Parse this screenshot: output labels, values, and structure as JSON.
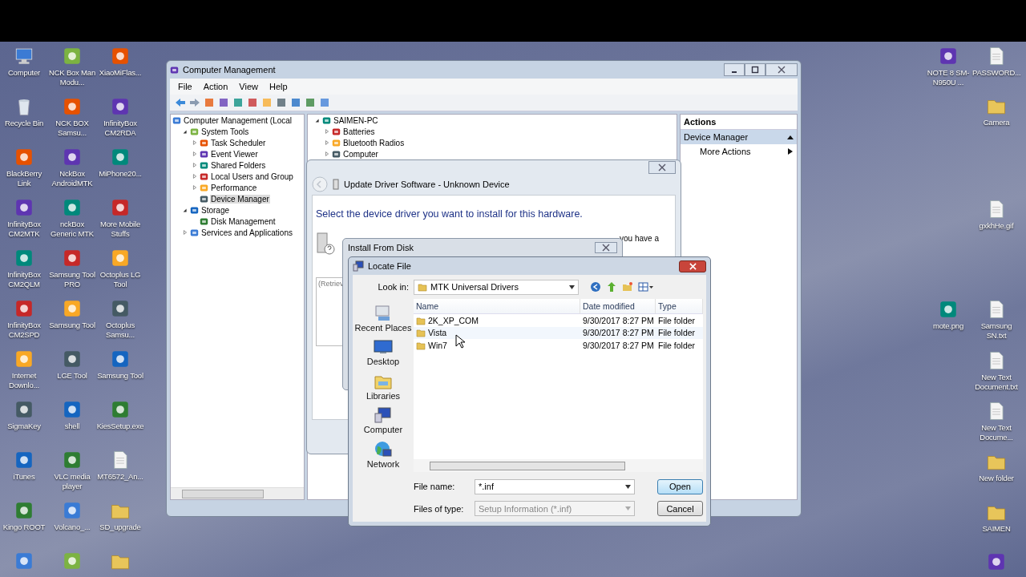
{
  "desktop": {
    "left_columns": [
      [
        {
          "label": "Computer",
          "kind": "computer"
        },
        {
          "label": "Recycle Bin",
          "kind": "bin"
        },
        {
          "label": "BlackBerry Link",
          "kind": "app"
        },
        {
          "label": "InfinityBox CM2MTK",
          "kind": "app"
        },
        {
          "label": "InfinityBox CM2QLM",
          "kind": "app"
        },
        {
          "label": "InfinityBox CM2SPD",
          "kind": "app"
        },
        {
          "label": "Internet Downlo...",
          "kind": "app"
        },
        {
          "label": "SigmaKey",
          "kind": "app"
        },
        {
          "label": "iTunes",
          "kind": "app"
        },
        {
          "label": "Kingo ROOT",
          "kind": "app"
        },
        {
          "kind": "app"
        }
      ],
      [
        {
          "label": "NCK Box Man Modu...",
          "kind": "app"
        },
        {
          "label": "NCK BOX Samsu...",
          "kind": "app"
        },
        {
          "label": "NckBox AndroidMTK",
          "kind": "app"
        },
        {
          "label": "nckBox Generic MTK",
          "kind": "app"
        },
        {
          "label": "Samsung Tool PRO",
          "kind": "app"
        },
        {
          "label": "Samsung Tool",
          "kind": "app"
        },
        {
          "label": "LGE Tool",
          "kind": "app"
        },
        {
          "label": "shell",
          "kind": "app"
        },
        {
          "label": "VLC media player",
          "kind": "app"
        },
        {
          "label": "Volcano_...",
          "kind": "app"
        },
        {
          "kind": "app"
        }
      ],
      [
        {
          "label": "XiaoMiFlas...",
          "kind": "app"
        },
        {
          "label": "InfinityBox CM2RDA",
          "kind": "app"
        },
        {
          "label": "MiPhone20...",
          "kind": "app"
        },
        {
          "label": "More Mobile Stuffs",
          "kind": "app"
        },
        {
          "label": "Octoplus LG Tool",
          "kind": "app"
        },
        {
          "label": "Octoplus Samsu...",
          "kind": "app"
        },
        {
          "label": "Samsung Tool",
          "kind": "app"
        },
        {
          "label": "KiesSetup.exe",
          "kind": "app"
        },
        {
          "label": "MT6572_An...",
          "kind": "document"
        },
        {
          "label": "SD_upgrade",
          "kind": "folder"
        },
        {
          "kind": "folder"
        }
      ]
    ],
    "right_columns": [
      [
        {
          "label": "NOTE 8 SM-N950U ...",
          "kind": "app"
        },
        {
          "label": "mote.png",
          "kind": "app"
        }
      ],
      [
        {
          "label": "PASSWORD...",
          "kind": "document"
        },
        {
          "label": "Camera",
          "kind": "folder"
        },
        {
          "label": "gxkhHe.gif",
          "kind": "document"
        },
        {
          "label": "Samsung SN.txt",
          "kind": "document"
        },
        {
          "label": "New Text Document.txt",
          "kind": "document"
        },
        {
          "label": "New Text Docume...",
          "kind": "document"
        },
        {
          "label": "New folder",
          "kind": "folder"
        },
        {
          "label": "SAIMEN",
          "kind": "folder"
        },
        {
          "kind": "app"
        }
      ]
    ]
  },
  "computer_management": {
    "title": "Computer Management",
    "menu": [
      "File",
      "Action",
      "View",
      "Help"
    ],
    "tree": [
      {
        "label": "Computer Management (Local",
        "selected": false,
        "children": [
          {
            "label": "System Tools",
            "expanded": true,
            "selected": false,
            "children": [
              {
                "label": "Task Scheduler",
                "expanded": false,
                "selected": false
              },
              {
                "label": "Event Viewer",
                "expanded": false,
                "selected": false
              },
              {
                "label": "Shared Folders",
                "expanded": false,
                "selected": false
              },
              {
                "label": "Local Users and Group",
                "expanded": false,
                "selected": false
              },
              {
                "label": "Performance",
                "expanded": false,
                "selected": false
              },
              {
                "label": "Device Manager",
                "selected": true
              }
            ]
          },
          {
            "label": "Storage",
            "expanded": true,
            "selected": false,
            "children": [
              {
                "label": "Disk Management",
                "selected": false
              }
            ]
          },
          {
            "label": "Services and Applications",
            "expanded": false,
            "selected": false
          }
        ]
      }
    ],
    "devices": [
      {
        "label": "SAIMEN-PC",
        "expanded": true,
        "children": [
          {
            "label": "Batteries",
            "expanded": false
          },
          {
            "label": "Bluetooth Radios",
            "expanded": false
          },
          {
            "label": "Computer",
            "expanded": false
          }
        ]
      }
    ],
    "actions": {
      "title": "Actions",
      "section": "Device Manager",
      "items": [
        "More Actions"
      ]
    }
  },
  "update_driver": {
    "title": "Update Driver Software - Unknown Device",
    "heading": "Select the device driver you want to install for this hardware.",
    "side_text": "you have a",
    "list_text": "(Retriev"
  },
  "install_from_disk": {
    "title": "Install From Disk"
  },
  "locate_file": {
    "title": "Locate File",
    "look_in_label": "Look in:",
    "look_in": "MTK Universal Drivers",
    "places": [
      {
        "label": "Recent Places",
        "kind": "recent"
      },
      {
        "label": "Desktop",
        "kind": "desktop"
      },
      {
        "label": "Libraries",
        "kind": "libraries"
      },
      {
        "label": "Computer",
        "kind": "computer"
      },
      {
        "label": "Network",
        "kind": "network"
      }
    ],
    "columns": [
      "Name",
      "Date modified",
      "Type"
    ],
    "rows": [
      {
        "name": "2K_XP_COM",
        "date": "9/30/2017 8:27 PM",
        "type": "File folder",
        "hovered": false
      },
      {
        "name": "Vista",
        "date": "9/30/2017 8:27 PM",
        "type": "File folder",
        "hovered": true
      },
      {
        "name": "Win7",
        "date": "9/30/2017 8:27 PM",
        "type": "File folder",
        "hovered": false
      }
    ],
    "file_name_label": "File name:",
    "file_name": "*.inf",
    "file_type_label": "Files of type:",
    "file_type": "Setup Information (*.inf)",
    "file_type_disabled": true,
    "buttons": [
      {
        "label": "Open",
        "default": true
      },
      {
        "label": "Cancel",
        "default": false
      }
    ]
  }
}
